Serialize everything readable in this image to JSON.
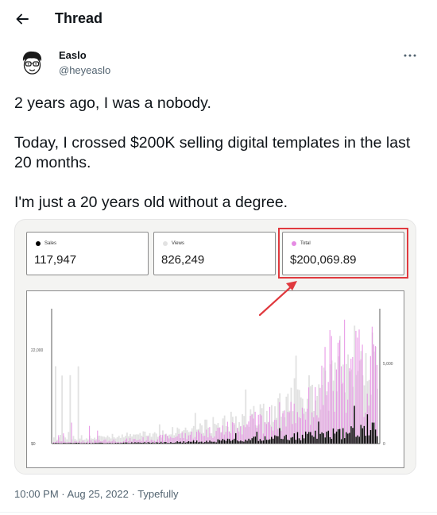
{
  "header": {
    "title": "Thread"
  },
  "author": {
    "name": "Easlo",
    "handle": "@heyeaslo"
  },
  "tweet": {
    "paragraphs": [
      "2 years ago, I was a nobody.",
      "Today, I crossed $200K selling digital templates in the last 20 months.",
      "I'm just a 20 years old without a degree."
    ]
  },
  "media": {
    "stats": [
      {
        "label": "Sales",
        "value": "117,947",
        "dot_color": "#000000"
      },
      {
        "label": "Views",
        "value": "826,249",
        "dot_color": "#e2e2e2"
      },
      {
        "label": "Total",
        "value": "$200,069.89",
        "dot_color": "#e58be3"
      }
    ],
    "highlight_color": "#e0393e"
  },
  "chart_data": {
    "type": "bar",
    "series": [
      {
        "name": "Sales",
        "color": "#000000",
        "scale": "right"
      },
      {
        "name": "Views",
        "color": "#e2e2e2",
        "scale": "left"
      },
      {
        "name": "Total",
        "color": "#e58be3",
        "scale": "left"
      }
    ],
    "left_axis": {
      "ticks": [
        "$0",
        "22,000"
      ],
      "ylim": [
        0,
        38000
      ]
    },
    "right_axis": {
      "ticks": [
        "0",
        "5,000"
      ],
      "ylim": [
        0,
        11000
      ]
    },
    "grid": false
  },
  "footer": {
    "time": "10:00 PM",
    "date": "Aug 25, 2022",
    "source": "Typefully",
    "separator": " · "
  }
}
